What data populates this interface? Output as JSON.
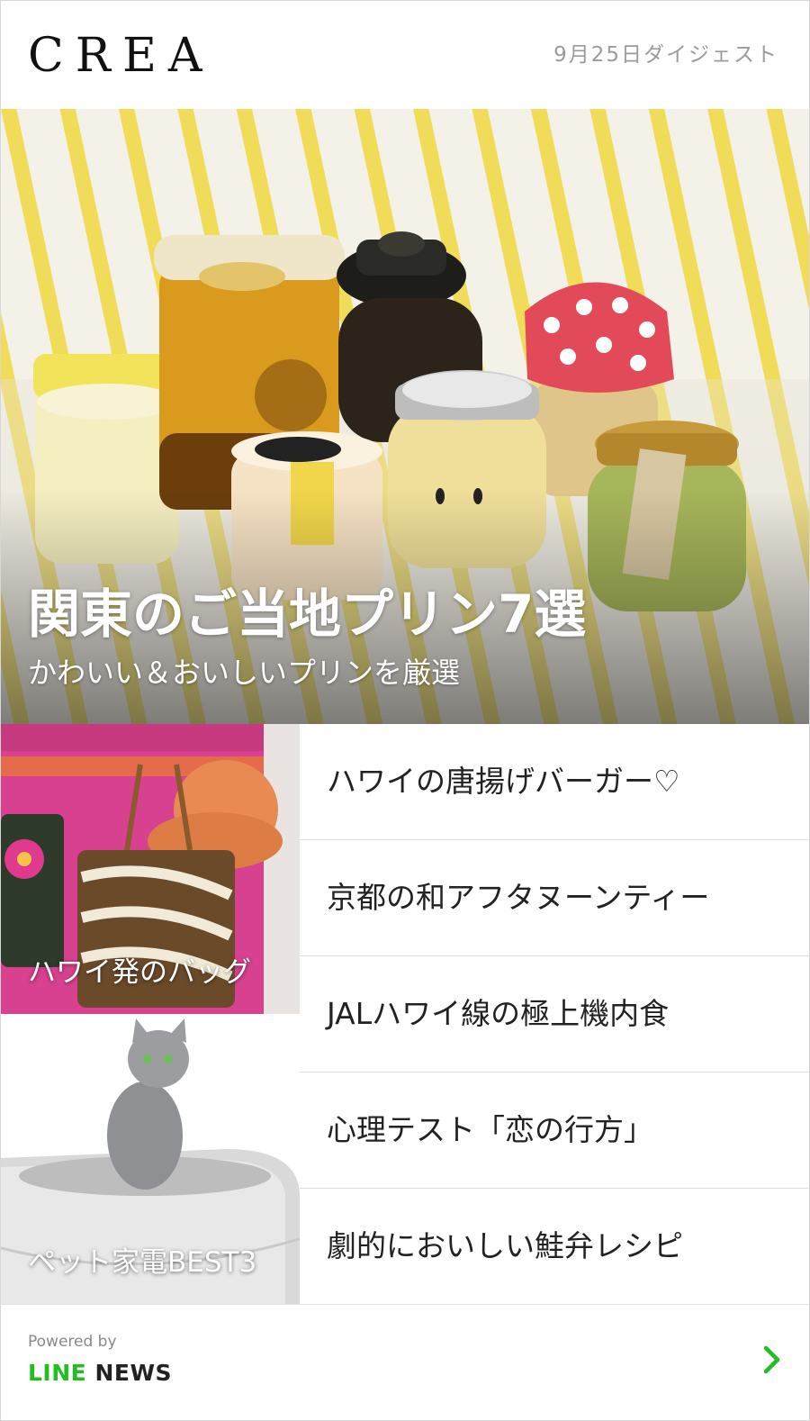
{
  "header": {
    "logo": "CREA",
    "digest_date": "9月25日ダイジェスト"
  },
  "hero": {
    "title": "関東のご当地プリン7選",
    "subtitle": "かわいい＆おいしいプリンを厳選"
  },
  "tiles": [
    {
      "label": "ハワイ発のバッグ"
    },
    {
      "label": "ペット家電BEST3"
    }
  ],
  "articles": [
    "ハワイの唐揚げバーガー♡",
    "京都の和アフタヌーンティー",
    "JALハワイ線の極上機内食",
    "心理テスト「恋の行方」",
    "劇的においしい鮭弁レシピ"
  ],
  "footer": {
    "powered_by": "Powered by",
    "brand_line": "LINE",
    "brand_news": "NEWS"
  },
  "colors": {
    "line_green": "#1fbf1f",
    "stripe_yellow": "#f1dc5a"
  }
}
